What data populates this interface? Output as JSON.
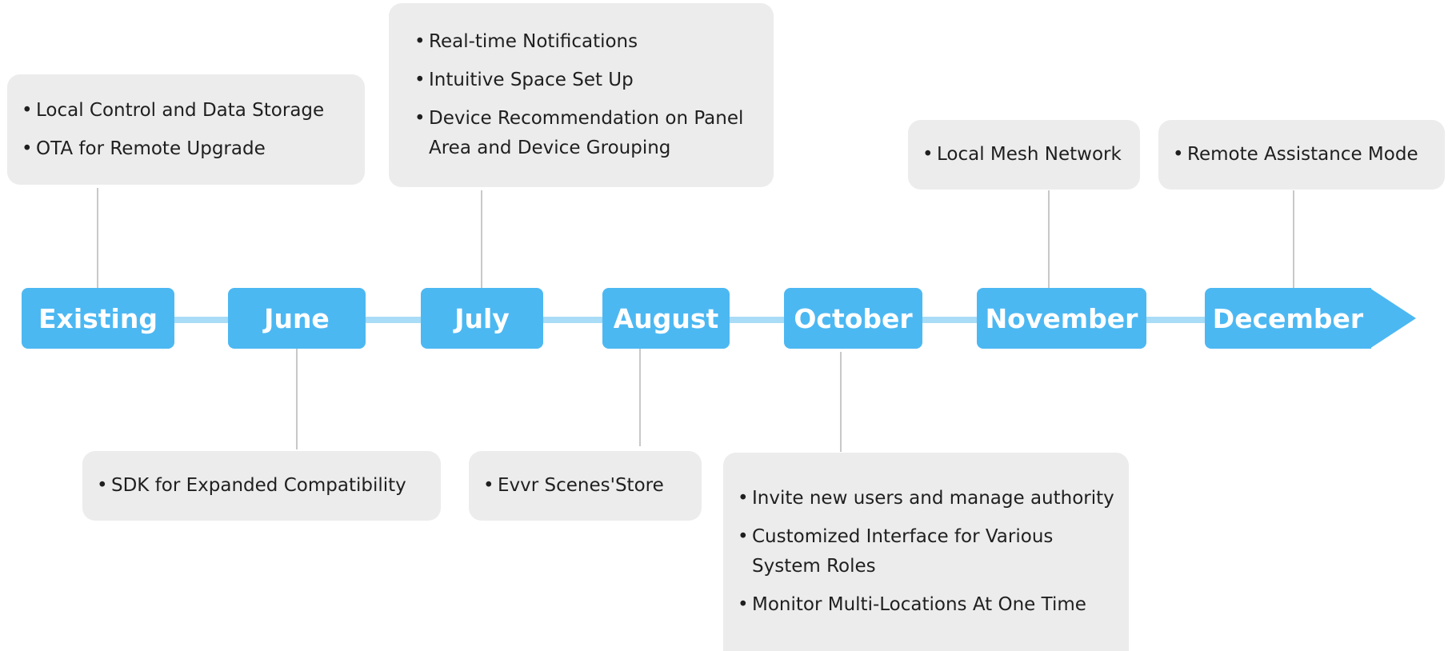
{
  "timeline": {
    "months": [
      {
        "label": "Existing"
      },
      {
        "label": "June"
      },
      {
        "label": "July"
      },
      {
        "label": "August"
      },
      {
        "label": "October"
      },
      {
        "label": "November"
      },
      {
        "label": "December"
      }
    ],
    "features": {
      "existing": [
        "Local Control and Data Storage",
        "OTA for Remote Upgrade"
      ],
      "june": [
        "SDK for Expanded Compatibility"
      ],
      "july": [
        "Real-time Notifications",
        "Intuitive Space Set Up",
        "Device Recommendation on Panel Area and Device Grouping"
      ],
      "august": [
        "Evvr Scenes'Store"
      ],
      "october": [
        "Invite new users and manage authority",
        "Customized Interface for Various System Roles",
        "Monitor Multi-Locations At One Time"
      ],
      "november": [
        "Local Mesh Network"
      ],
      "december": [
        "Remote Assistance Mode"
      ]
    }
  },
  "colors": {
    "accent": "#4cb8f2",
    "axis": "#a9dcf7",
    "card": "#ececec",
    "connector": "#c8c8c8"
  }
}
